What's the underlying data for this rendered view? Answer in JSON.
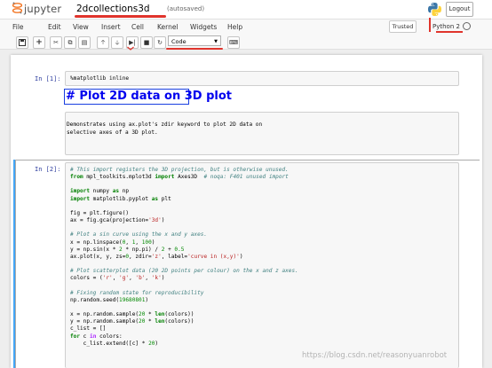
{
  "header": {
    "app_name": "jupyter",
    "notebook_name": "2dcollections3d",
    "autosave_status": "(autosaved)",
    "logout_label": "Logout"
  },
  "menu": {
    "items": [
      "File",
      "Edit",
      "View",
      "Insert",
      "Cell",
      "Kernel",
      "Widgets",
      "Help"
    ],
    "trusted_label": "Trusted",
    "kernel_name": "Python 2"
  },
  "toolbar": {
    "cell_type": "Code"
  },
  "cells": [
    {
      "prompt": "In  [1]:",
      "source": "%matplotlib inline"
    },
    {
      "md_title": "# Plot 2D data on 3D plot",
      "md_text": "Demonstrates using ax.plot's zdir keyword to plot 2D data on\nselective axes of a 3D plot."
    },
    {
      "prompt": "In  [2]:"
    }
  ],
  "watermark": "https://blog.csdn.net/reasonyuanrobot",
  "colors": {
    "accent": "#e0342c",
    "selected": "#42a5f5",
    "prompt": "#303f9f"
  }
}
